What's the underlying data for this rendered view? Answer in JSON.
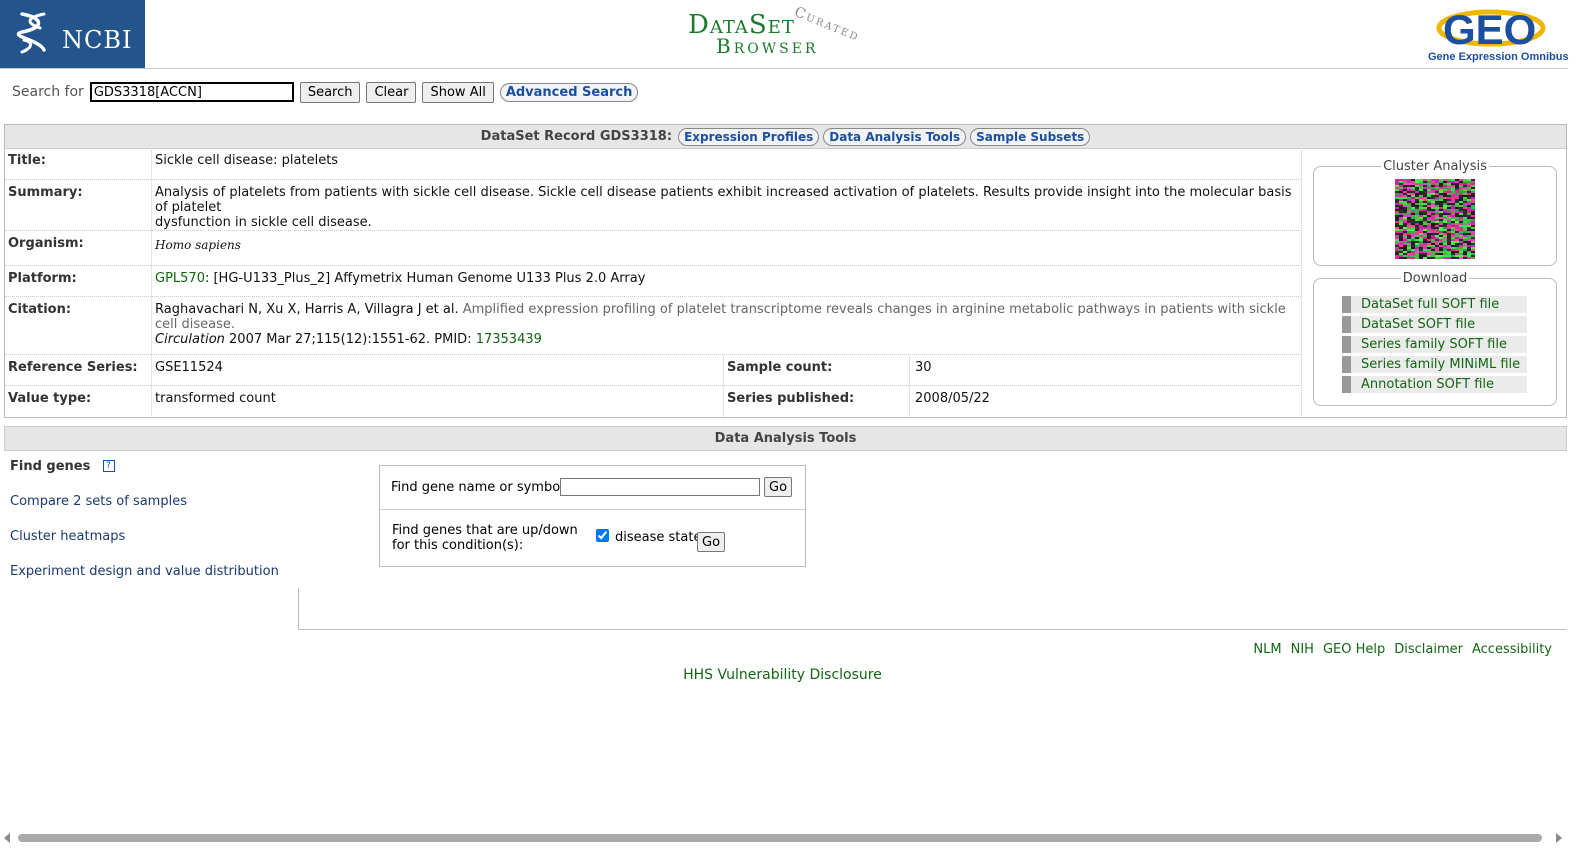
{
  "header": {
    "ncbi": "NCBI",
    "browser_line1": "DataSet",
    "browser_line2": "Browser",
    "curated": "Curated",
    "geo": "GEO",
    "geo_tagline": "Gene Expression Omnibus"
  },
  "search": {
    "label": "Search for",
    "value": "GDS3318[ACCN]",
    "search_btn": "Search",
    "clear_btn": "Clear",
    "show_all_btn": "Show All",
    "advanced_btn": "Advanced Search"
  },
  "record": {
    "title_prefix": "DataSet Record GDS3318:",
    "tabs": [
      "Expression Profiles",
      "Data Analysis Tools",
      "Sample Subsets"
    ],
    "labels": {
      "title": "Title:",
      "summary": "Summary:",
      "organism": "Organism:",
      "platform": "Platform:",
      "citation": "Citation:",
      "ref_series": "Reference Series:",
      "sample_count": "Sample count:",
      "value_type": "Value type:",
      "series_published": "Series published:"
    },
    "title": "Sickle cell disease: platelets",
    "summary_line1": "Analysis of platelets from patients with sickle cell disease. Sickle cell disease patients exhibit increased activation of platelets. Results provide insight into the molecular basis of platelet",
    "summary_line2": "dysfunction in sickle cell disease.",
    "organism": "Homo sapiens",
    "platform_id": "GPL570",
    "platform_desc": ": [HG-U133_Plus_2] Affymetrix Human Genome U133 Plus 2.0 Array",
    "citation_authors": "Raghavachari N, Xu X, Harris A, Villagra J et al.",
    "citation_title": "Amplified expression profiling of platelet transcriptome reveals changes in arginine metabolic pathways in patients with sickle cell disease.",
    "citation_journal": "Circulation",
    "citation_ref": " 2007 Mar 27;115(12):1551-62. PMID: ",
    "citation_pmid": "17353439",
    "ref_series": "GSE11524",
    "sample_count": "30",
    "value_type": "transformed count",
    "series_published": "2008/05/22"
  },
  "sidebar": {
    "cluster_title": "Cluster Analysis",
    "download_title": "Download",
    "downloads": [
      "DataSet full SOFT file",
      "DataSet SOFT file",
      "Series family SOFT file",
      "Series family MINiML file",
      "Annotation SOFT file"
    ]
  },
  "tools": {
    "bar_title": "Data Analysis Tools",
    "find_genes": "Find genes",
    "help_icon": "?",
    "links": [
      "Compare 2 sets of samples",
      "Cluster heatmaps",
      "Experiment design and value distribution"
    ],
    "find_label": "Find gene name or symbol:",
    "find_value": "",
    "go": "Go",
    "updown_line1": "Find genes that are up/down",
    "updown_line2": "for this condition(s):",
    "condition": "disease state",
    "condition_checked": true
  },
  "footer": {
    "links": [
      "NLM",
      "NIH",
      "GEO Help",
      "Disclaimer",
      "Accessibility"
    ],
    "hhs": "HHS Vulnerability Disclosure"
  },
  "colors": {
    "ncbi_blue": "#23558c",
    "link_green": "#116611",
    "link_navy": "#1a3a6e",
    "bar_gray": "#e6e6e6"
  }
}
